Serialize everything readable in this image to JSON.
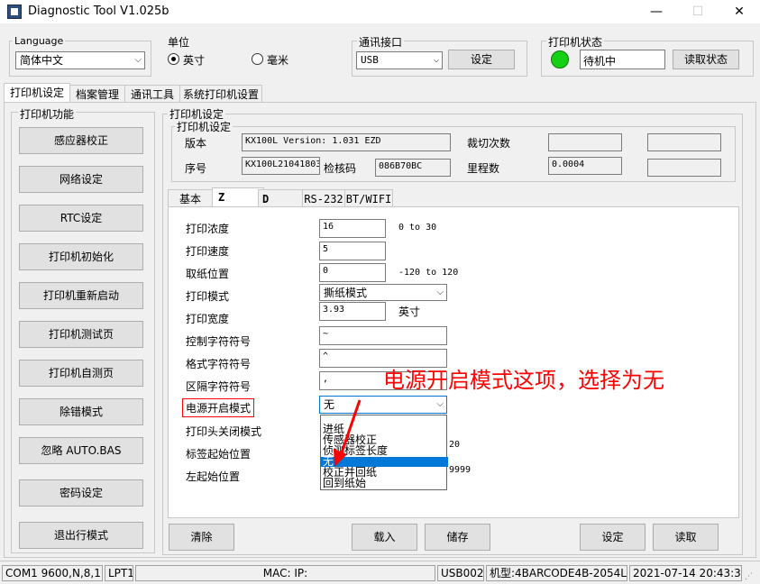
{
  "window": {
    "title": "Diagnostic Tool V1.025b",
    "minimize": "—",
    "maximize": "☐",
    "close": "✕"
  },
  "top": {
    "language_label": "Language",
    "language_value": "简体中文",
    "unit_label": "单位",
    "unit_inch": "英寸",
    "unit_mm": "毫米",
    "unit_selected": "英寸",
    "port_label": "通讯接口",
    "port_value": "USB",
    "port_set": "设定",
    "status_label": "打印机状态",
    "status_value": "待机中",
    "status_read": "读取状态",
    "status_color": "#16d016"
  },
  "main_tabs": [
    "打印机设定",
    "档案管理",
    "通讯工具",
    "系统打印机设置"
  ],
  "left_panel": {
    "title": "打印机功能",
    "buttons": [
      "感应器校正",
      "网络设定",
      "RTC设定",
      "打印机初始化",
      "打印机重新启动",
      "打印机测试页",
      "打印机自测页",
      "除错模式",
      "忽略 AUTO.BAS",
      "密码设定",
      "退出行模式"
    ]
  },
  "settings": {
    "outer_title": "打印机设定",
    "inner_title": "打印机设定",
    "version_label": "版本",
    "version_value": "KX100L Version: 1.031 EZD",
    "serial_label": "序号",
    "serial_value": "KX100L21041803",
    "checksum_label": "检核码",
    "checksum_value": "086B70BC",
    "cut_label": "裁切次数",
    "cut_value": "",
    "mileage_label": "里程数",
    "mileage_value": "0.0004"
  },
  "sub_tabs": [
    "基本",
    "Z",
    "D",
    "RS-232",
    "BT/WIFI"
  ],
  "form": {
    "density_label": "打印浓度",
    "density_value": "16",
    "density_range": "0 to 30",
    "speed_label": "打印速度",
    "speed_value": "5",
    "tear_label": "取纸位置",
    "tear_value": "0",
    "tear_range": "-120 to 120",
    "mode_label": "打印模式",
    "mode_value": "撕纸模式",
    "width_label": "打印宽度",
    "width_value": "3.93",
    "width_unit": "英寸",
    "ctrl_label": "控制字符符号",
    "ctrl_value": "~",
    "fmt_label": "格式字符符号",
    "fmt_value": "^",
    "delim_label": "区隔字符符号",
    "delim_value": ",",
    "power_label": "电源开启模式",
    "power_value": "无",
    "head_label": "打印头关闭模式",
    "label_top_label": "标签起始位置",
    "label_top_partial": "20",
    "left_pos_label": "左起始位置",
    "left_pos_partial": "9999"
  },
  "dropdown": {
    "items": [
      "进纸",
      "传感器校正",
      "侦测标签长度",
      "无",
      "校正并回纸",
      "回到纸始"
    ],
    "selected_index": 3
  },
  "annotation": "电源开启模式这项，选择为无",
  "bottom_buttons": {
    "clear": "清除",
    "load": "载入",
    "save": "储存",
    "set": "设定",
    "read": "读取"
  },
  "statusbar": {
    "com": "COM1 9600,N,8,1",
    "lpt": "LPT1",
    "mac": "MAC: IP:",
    "usb": "USB002",
    "model": "机型:4BARCODE4B-2054L",
    "datetime": "2021-07-14 20:43:34"
  },
  "colors": {
    "accent": "#0078d7",
    "annotation": "#ff0000"
  }
}
